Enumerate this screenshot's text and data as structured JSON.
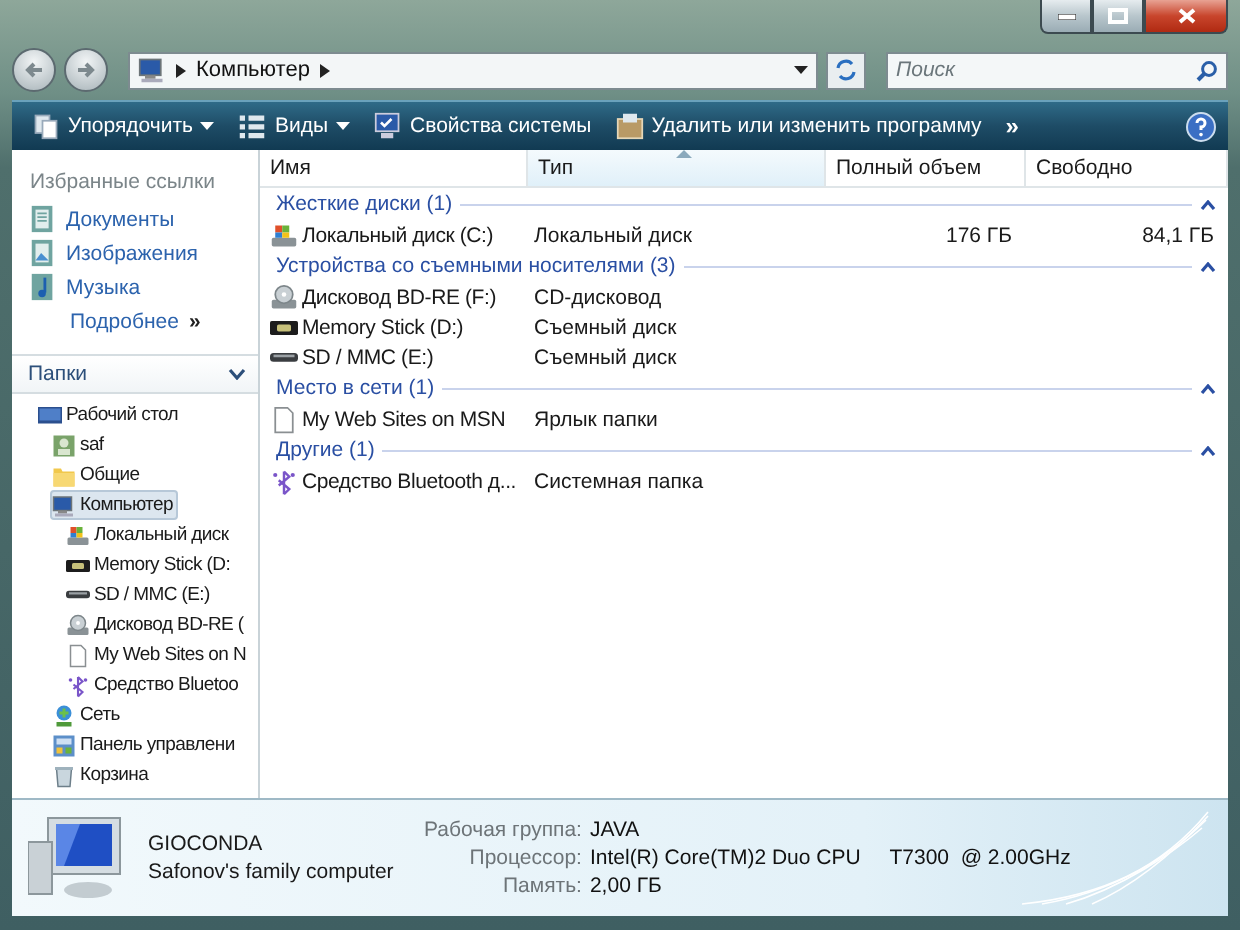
{
  "address": {
    "crumbs": [
      "Компьютер"
    ]
  },
  "search": {
    "placeholder": "Поиск"
  },
  "toolbar": [
    {
      "label": "Упорядочить",
      "kind": "organize",
      "dropdown": true
    },
    {
      "label": "Виды",
      "kind": "views",
      "dropdown": true
    },
    {
      "label": "Свойства системы",
      "kind": "properties",
      "dropdown": false
    },
    {
      "label": "Удалить или изменить программу",
      "kind": "uninstall",
      "dropdown": false
    }
  ],
  "toolbar_more": "»",
  "favorites": {
    "title": "Избранные ссылки",
    "items": [
      {
        "label": "Документы",
        "kind": "docs"
      },
      {
        "label": "Изображения",
        "kind": "pictures"
      },
      {
        "label": "Музыка",
        "kind": "music"
      }
    ],
    "more": "Подробнее",
    "more_glyph": "»"
  },
  "folders": {
    "title": "Папки",
    "expanded": true,
    "tree": [
      {
        "label": "Рабочий стол",
        "kind": "desktop",
        "selected": false,
        "children": [
          {
            "label": "saf",
            "kind": "user",
            "selected": false
          },
          {
            "label": "Общие",
            "kind": "folder",
            "selected": false
          },
          {
            "label": "Компьютер",
            "kind": "computer",
            "selected": true,
            "children": [
              {
                "label": "Локальный диск",
                "kind": "drive",
                "selected": false
              },
              {
                "label": "Memory Stick (D:",
                "kind": "memstick",
                "selected": false
              },
              {
                "label": "SD / MMC (E:)",
                "kind": "card",
                "selected": false
              },
              {
                "label": "Дисковод BD-RE (",
                "kind": "optical",
                "selected": false
              },
              {
                "label": "My Web Sites on N",
                "kind": "file",
                "selected": false
              },
              {
                "label": "Средство Bluetoo",
                "kind": "bluetooth",
                "selected": false
              }
            ]
          },
          {
            "label": "Сеть",
            "kind": "network",
            "selected": false
          },
          {
            "label": "Панель управлени",
            "kind": "control",
            "selected": false
          },
          {
            "label": "Корзина",
            "kind": "trash",
            "selected": false
          }
        ]
      }
    ]
  },
  "table": {
    "columns": [
      {
        "label": "Имя",
        "sorted": false
      },
      {
        "label": "Тип",
        "sorted": true
      },
      {
        "label": "Полный объем",
        "sorted": false
      },
      {
        "label": "Свободно",
        "sorted": false
      }
    ],
    "groups": [
      {
        "title": "Жесткие диски (1)",
        "expanded": true,
        "rows": [
          {
            "name": "Локальный диск (C:)",
            "kind": "drive",
            "type": "Локальный диск",
            "total": "176 ГБ",
            "free": "84,1 ГБ"
          }
        ]
      },
      {
        "title": "Устройства со съемными носителями (3)",
        "expanded": true,
        "rows": [
          {
            "name": "Дисковод BD-RE (F:)",
            "kind": "optical",
            "type": "CD-дисковод"
          },
          {
            "name": "Memory Stick (D:)",
            "kind": "memstick",
            "type": "Съемный диск"
          },
          {
            "name": "SD / MMC (E:)",
            "kind": "card",
            "type": "Съемный диск"
          }
        ]
      },
      {
        "title": "Место в сети (1)",
        "expanded": true,
        "rows": [
          {
            "name": "My Web Sites on MSN",
            "kind": "file",
            "type": "Ярлык папки"
          }
        ]
      },
      {
        "title": "Другие (1)",
        "expanded": true,
        "rows": [
          {
            "name": "Средство Bluetooth д...",
            "kind": "bluetooth",
            "type": "Системная папка"
          }
        ]
      }
    ]
  },
  "details": {
    "name": "GIOCONDA",
    "description": "Safonov's family computer",
    "fields": [
      {
        "label": "Рабочая группа:",
        "value": "JAVA"
      },
      {
        "label": "Процессор:",
        "value": "Intel(R) Core(TM)2 Duo CPU     T7300  @ 2.00GHz"
      },
      {
        "label": "Память:",
        "value": "2,00 ГБ"
      }
    ]
  }
}
